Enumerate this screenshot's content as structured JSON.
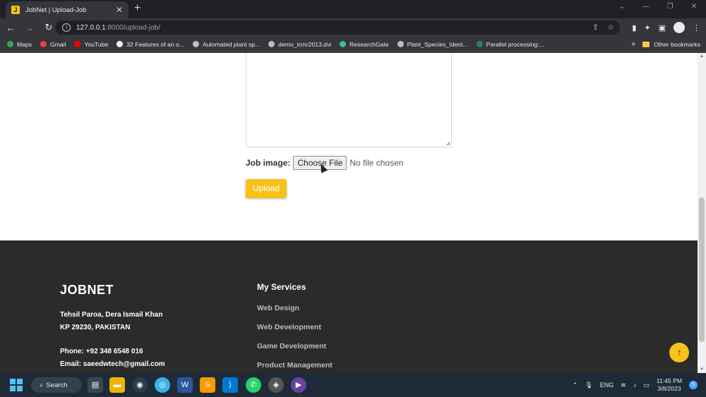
{
  "browser": {
    "tab_title": "JobNet | Upload-Job",
    "tab_favicon": "J",
    "new_tab_label": "+",
    "url_host": "127.0.0.1",
    "url_rest": ":8000/upload-job/",
    "bookmarks": [
      {
        "label": "Maps",
        "color": "#34a853"
      },
      {
        "label": "Gmail",
        "color": "#ea4335"
      },
      {
        "label": "YouTube",
        "color": "#ff0000"
      },
      {
        "label": "32 Features of an o...",
        "color": "#ffffff"
      },
      {
        "label": "Automated plant sp...",
        "color": "#bdbdbd"
      },
      {
        "label": "demo_icmr2013.dvi",
        "color": "#bdbdbd"
      },
      {
        "label": "ResearchGate",
        "color": "#40ba9b"
      },
      {
        "label": "Plant_Species_Ident...",
        "color": "#bdbdbd"
      },
      {
        "label": "Parallel processing:...",
        "color": "#2d7d6f"
      }
    ],
    "more_label": "»",
    "other_bookmarks": "Other bookmarks"
  },
  "form": {
    "job_image_label": "Job image:",
    "choose_file": "Choose File",
    "no_file": "No file chosen",
    "upload": "Upload"
  },
  "footer": {
    "brand": "JOBNET",
    "address_line1": "Tehsil Paroa, Dera Ismail Khan",
    "address_line2": "KP 29230, PAKISTAN",
    "phone": "Phone: +92 348 6548 016",
    "email": "Email: saeedwtech@gmail.com",
    "services_title": "My Services",
    "services": [
      "Web Design",
      "Web Development",
      "Game Development",
      "Product Management"
    ],
    "back_to_top": "↑"
  },
  "taskbar": {
    "search": "Search",
    "lang": "ENG",
    "time": "11:45 PM",
    "date": "3/8/2023",
    "notif_count": "5"
  }
}
